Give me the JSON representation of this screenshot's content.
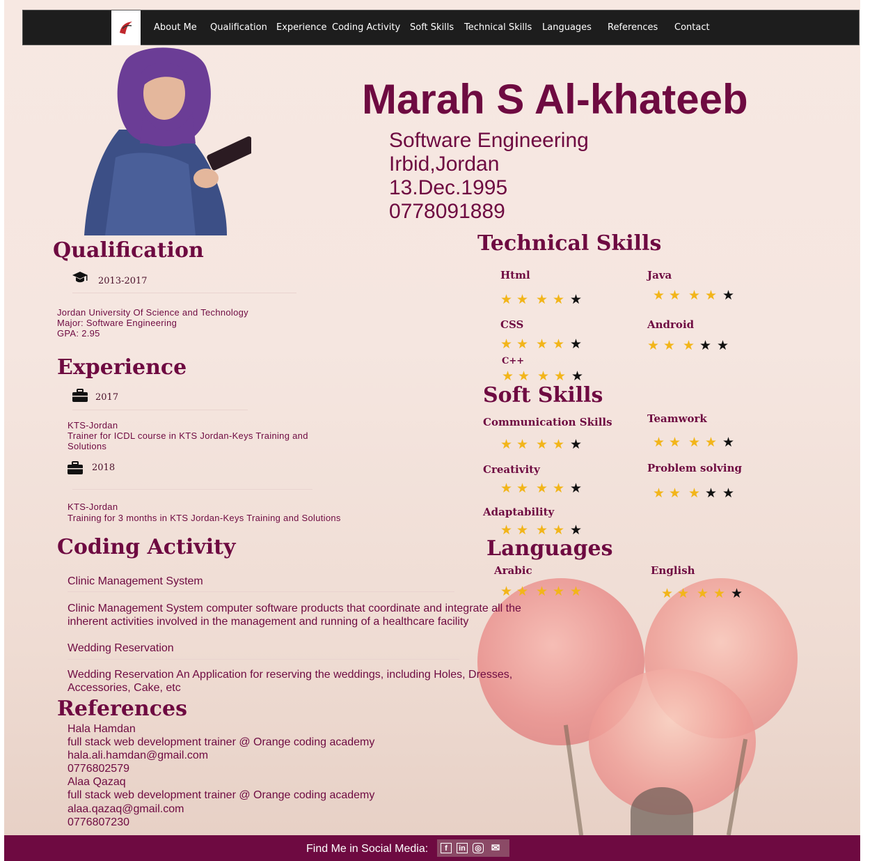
{
  "nav": {
    "items": [
      "About Me",
      "Qualification",
      "Experience",
      "Coding Activity",
      "Soft Skills",
      "Technical Skills",
      "Languages",
      "References",
      "Contact"
    ]
  },
  "header": {
    "name": "Marah S Al-khateeb",
    "major": "Software Engineering",
    "location": "Irbid,Jordan",
    "birthdate": "13.Dec.1995",
    "phone": "0778091889"
  },
  "qualification": {
    "title": "Qualification",
    "years": "2013-2017",
    "university": "Jordan University Of Science and Technology",
    "major": "Major: Software Engineering",
    "gpa": "GPA: 2.95"
  },
  "experience": {
    "title": "Experience",
    "items": [
      {
        "year": "2017",
        "company": "KTS-Jordan",
        "desc": "Trainer for ICDL course in KTS Jordan-Keys Training and Solutions"
      },
      {
        "year": "2018",
        "company": "KTS-Jordan",
        "desc": "Training for 3 months in KTS Jordan-Keys Training and Solutions"
      }
    ]
  },
  "coding": {
    "title": "Coding Activity",
    "items": [
      {
        "name": "Clinic Management System",
        "desc": "Clinic Management System computer software products that coordinate and integrate all the inherent activities involved in the management and running of a healthcare facility"
      },
      {
        "name": "Wedding Reservation",
        "desc": "Wedding Reservation An Application for reserving the weddings, including Holes, Dresses, Accessories, Cake, etc"
      }
    ]
  },
  "references": {
    "title": "References",
    "lines": [
      "Hala Hamdan",
      "full stack web development trainer @ Orange coding academy",
      "hala.ali.hamdan@gmail.com",
      "0776802579",
      "Alaa Qazaq",
      "full stack web development trainer @ Orange coding academy",
      "alaa.qazaq@gmail.com",
      "0776807230"
    ]
  },
  "technical": {
    "title": "Technical Skills",
    "skills": [
      {
        "name": "Html",
        "rating": 4,
        "total": 5
      },
      {
        "name": "Java",
        "rating": 4,
        "total": 5
      },
      {
        "name": "CSS",
        "rating": 4,
        "total": 5
      },
      {
        "name": "Android",
        "rating": 3,
        "total": 5
      },
      {
        "name": "C++",
        "rating": 4,
        "total": 5
      }
    ]
  },
  "soft": {
    "title": "Soft Skills",
    "skills": [
      {
        "name": "Communication Skills",
        "rating": 4,
        "total": 5
      },
      {
        "name": "Teamwork",
        "rating": 4,
        "total": 5
      },
      {
        "name": "Creativity",
        "rating": 4,
        "total": 5
      },
      {
        "name": "Problem solving",
        "rating": 3,
        "total": 5
      },
      {
        "name": "Adaptability",
        "rating": 4,
        "total": 5
      }
    ]
  },
  "languages": {
    "title": "Languages",
    "skills": [
      {
        "name": "Arabic",
        "rating": 5,
        "total": 5
      },
      {
        "name": "English",
        "rating": 4,
        "total": 5
      }
    ]
  },
  "footer": {
    "text": "Find Me in Social Media:",
    "icons": [
      "facebook-icon",
      "linkedin-icon",
      "instagram-icon",
      "email-icon"
    ]
  },
  "colors": {
    "accent": "#6e0a41",
    "star_filled": "#f2b51a",
    "star_empty": "#111111",
    "nav_bg": "#1d1d1d"
  }
}
